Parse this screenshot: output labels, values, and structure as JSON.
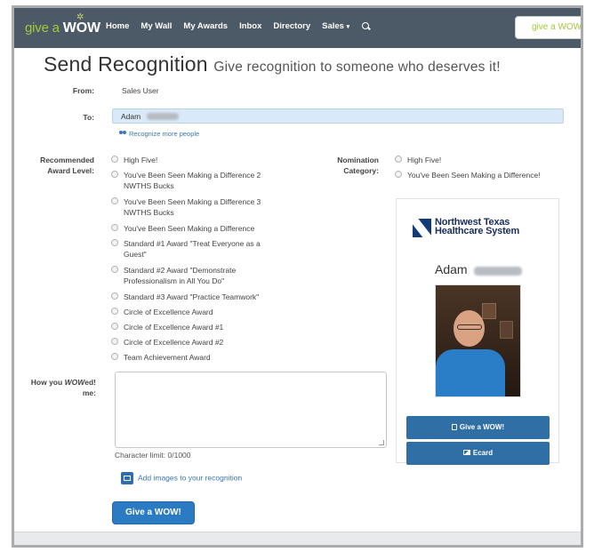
{
  "navbar": {
    "brand_prefix": "give a",
    "brand_word": "WOW",
    "items": [
      "Home",
      "My Wall",
      "My Awards",
      "Inbox",
      "Directory",
      "Sales"
    ],
    "sales_caret": "▾",
    "right_brand": "give a WOW"
  },
  "page": {
    "title": "Send Recognition",
    "subtitle": "Give recognition to someone who deserves it!"
  },
  "form": {
    "from_label": "From:",
    "from_value": "Sales User",
    "to_label": "To:",
    "to_value": "Adam",
    "recognize_more": "Recognize more people",
    "award_level_label_1": "Recommended",
    "award_level_label_2": "Award Level:",
    "award_levels": [
      "High Five!",
      "You've Been Seen Making a Difference 2 NWTHS Bucks",
      "You've Been Seen Making a Difference 3 NWTHS Bucks",
      "You've Been Seen Making a Difference",
      "Standard #1 Award \"Treat Everyone as a Guest\"",
      "Standard #2 Award \"Demonstrate Professionalism in All You Do\"",
      "Standard #3 Award \"Practice Teamwork\"",
      "Circle of Excellence Award",
      "Circle of Excellence Award #1",
      "Circle of Excellence Award #2",
      "Team Achievement Award"
    ],
    "nomination_label_1": "Nomination",
    "nomination_label_2": "Category:",
    "nomination_categories": [
      "High Five!",
      "You've Been Seen Making a Difference!"
    ],
    "wowed_label_1": "How you",
    "wowed_label_em": "WOW",
    "wowed_label_2": "ed!",
    "wowed_label_3": "me:",
    "message_value": "",
    "char_limit": "Character limit: 0/1000",
    "add_images": "Add images to your recognition",
    "submit": "Give a WOW!"
  },
  "card": {
    "org_line_1": "Northwest Texas",
    "org_line_2": "Healthcare System",
    "name": "Adam",
    "give_wow": "Give a WOW!",
    "ecard": "Ecard"
  },
  "colors": {
    "navbar": "#4c5966",
    "brand_green": "#a6c93a",
    "primary_button": "#2b7bc2",
    "card_button": "#2f6fa6",
    "to_field": "#d9e9f8"
  }
}
